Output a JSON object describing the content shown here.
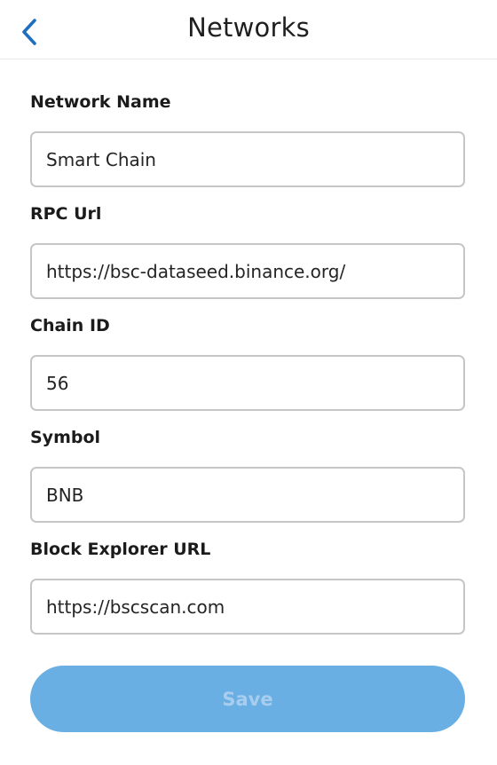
{
  "header": {
    "title": "Networks",
    "back_icon": "chevron-left-icon",
    "accent_color": "#1e6fc0"
  },
  "form": {
    "network_name": {
      "label": "Network Name",
      "value": "Smart Chain"
    },
    "rpc_url": {
      "label": "RPC Url",
      "value": "https://bsc-dataseed.binance.org/"
    },
    "chain_id": {
      "label": "Chain ID",
      "value": "56"
    },
    "symbol": {
      "label": "Symbol",
      "value": "BNB"
    },
    "block_explorer_url": {
      "label": "Block Explorer URL",
      "value": "https://bscscan.com"
    }
  },
  "save_button": {
    "label": "Save",
    "color": "#6aafe3",
    "state": "disabled"
  }
}
